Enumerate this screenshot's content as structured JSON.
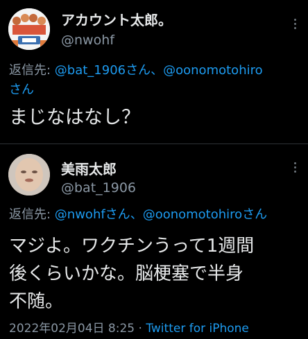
{
  "tweet1": {
    "display_name": "アカウント太郎。",
    "handle": "@nwohf",
    "reply_prefix": "返信先: ",
    "reply_mention1": "@bat_1906さん",
    "reply_sep": "、",
    "reply_mention2": "@oonomotohiro",
    "reply_suffix": "さん",
    "body": "まじなはなし？"
  },
  "tweet2": {
    "display_name": "美雨太郎",
    "handle": "@bat_1906",
    "reply_prefix": "返信先: ",
    "reply_mention1": "@nwohfさん",
    "reply_sep": "、",
    "reply_mention2": "@oonomotohiroさん",
    "body_line1": "マジよ。ワクチンうって1週間",
    "body_line2": "後くらいかな。脳梗塞で半身",
    "body_line3": "不随。",
    "timestamp": "2022年02月04日 8:25",
    "separator": " · ",
    "source": "Twitter for iPhone"
  },
  "colors": {
    "background": "#000000",
    "text": "#e7e9ea",
    "secondary": "#8b98a5",
    "link": "#1d9bf0"
  },
  "icons": [
    "more-icon"
  ]
}
